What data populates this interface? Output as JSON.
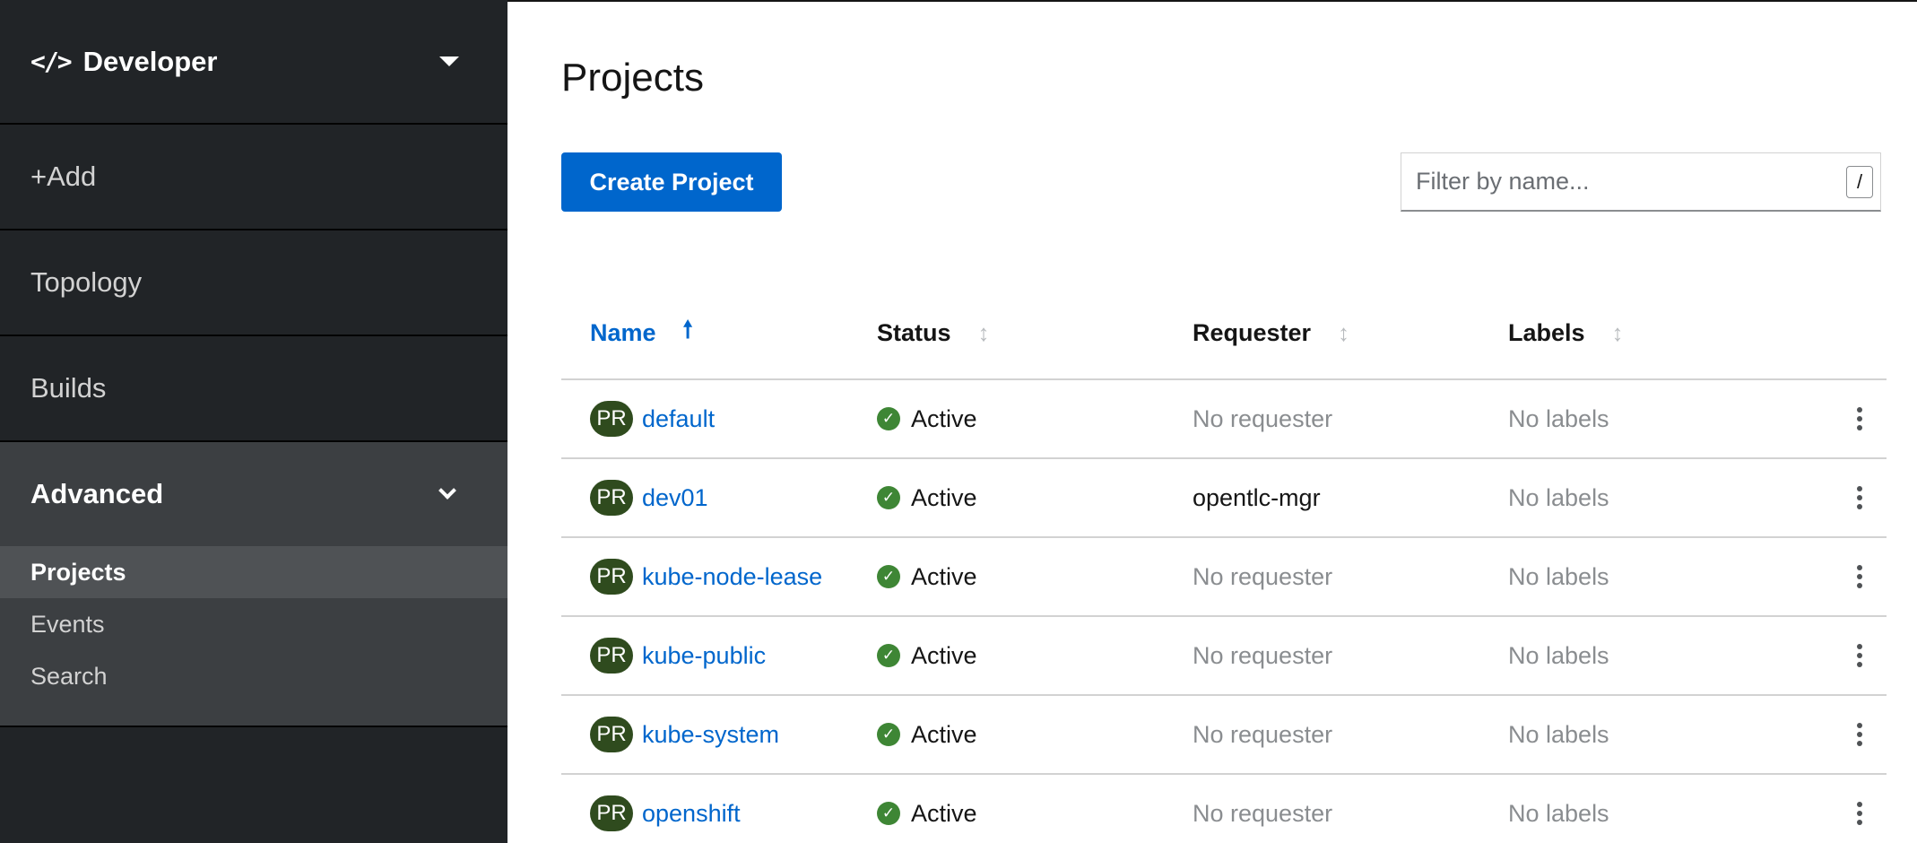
{
  "sidebar": {
    "perspective": {
      "icon": "code-icon",
      "label": "Developer"
    },
    "items": [
      {
        "label": "+Add"
      },
      {
        "label": "Topology"
      },
      {
        "label": "Builds"
      }
    ],
    "advanced": {
      "label": "Advanced",
      "subitems": [
        {
          "label": "Projects",
          "active": true
        },
        {
          "label": "Events"
        },
        {
          "label": "Search"
        }
      ]
    }
  },
  "main": {
    "title": "Projects",
    "create_button": "Create Project",
    "filter": {
      "placeholder": "Filter by name...",
      "shortcut": "/"
    },
    "table": {
      "headers": [
        "Name",
        "Status",
        "Requester",
        "Labels"
      ],
      "sort_column": "Name",
      "rows": [
        {
          "badge": "PR",
          "name": "default",
          "status": "Active",
          "requester": "No requester",
          "labels": "No labels"
        },
        {
          "badge": "PR",
          "name": "dev01",
          "status": "Active",
          "requester": "opentlc-mgr",
          "labels": "No labels"
        },
        {
          "badge": "PR",
          "name": "kube-node-lease",
          "status": "Active",
          "requester": "No requester",
          "labels": "No labels"
        },
        {
          "badge": "PR",
          "name": "kube-public",
          "status": "Active",
          "requester": "No requester",
          "labels": "No labels"
        },
        {
          "badge": "PR",
          "name": "kube-system",
          "status": "Active",
          "requester": "No requester",
          "labels": "No labels"
        },
        {
          "badge": "PR",
          "name": "openshift",
          "status": "Active",
          "requester": "No requester",
          "labels": "No labels"
        }
      ]
    }
  },
  "colors": {
    "sidebar_bg": "#212427",
    "accent": "#0066cc",
    "badge_bg": "#2f4b1e",
    "status_ok": "#3e8635"
  }
}
